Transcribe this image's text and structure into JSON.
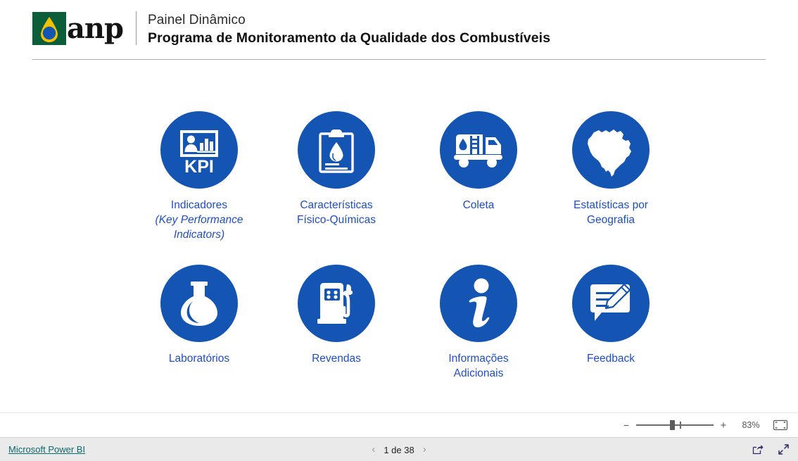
{
  "header": {
    "logo_alt": "anp",
    "logo_word": "anp",
    "subtitle": "Painel Dinâmico",
    "title": "Programa de Monitoramento da Qualidade dos Combustíveis"
  },
  "theme": {
    "circle_blue": "#1455b4",
    "label_blue": "#1f4ec4",
    "logo_green": "#0c5d3a",
    "logo_yellow": "#f2c200",
    "logo_blue": "#1455b4",
    "link_teal": "#0b6a6d",
    "bottom_bar_bg": "#eaeaea"
  },
  "tiles": [
    {
      "id": "indicadores",
      "icon": "kpi-icon",
      "label_line1": "Indicadores",
      "label_line2": "(Key Performance",
      "label_line3": "Indicators)",
      "kpi_text": "KPI"
    },
    {
      "id": "caracteristicas",
      "icon": "clipboard-droplet-icon",
      "label_line1": "Características",
      "label_line2": "Físico-Químicas",
      "label_line3": ""
    },
    {
      "id": "coleta",
      "icon": "tanker-truck-icon",
      "label_line1": "Coleta",
      "label_line2": "",
      "label_line3": ""
    },
    {
      "id": "estatisticas",
      "icon": "brazil-map-icon",
      "label_line1": "Estatísticas por",
      "label_line2": "Geografia",
      "label_line3": ""
    },
    {
      "id": "laboratorios",
      "icon": "flask-icon",
      "label_line1": "Laboratórios",
      "label_line2": "",
      "label_line3": ""
    },
    {
      "id": "revendas",
      "icon": "fuel-pump-icon",
      "label_line1": "Revendas",
      "label_line2": "",
      "label_line3": ""
    },
    {
      "id": "informacoes",
      "icon": "info-icon",
      "label_line1": "Informações",
      "label_line2": "Adicionais",
      "label_line3": ""
    },
    {
      "id": "feedback",
      "icon": "feedback-icon",
      "label_line1": "Feedback",
      "label_line2": "",
      "label_line3": ""
    }
  ],
  "zoombar": {
    "minus_label": "−",
    "plus_label": "+",
    "zoom_level": "83%",
    "fit_icon": "fit-to-page-icon"
  },
  "bottombar": {
    "brand_link": "Microsoft Power BI",
    "prev_label": "‹",
    "page_text": "1 de 38",
    "next_label": "›",
    "share_icon": "share-icon",
    "fullscreen_icon": "fullscreen-icon"
  }
}
